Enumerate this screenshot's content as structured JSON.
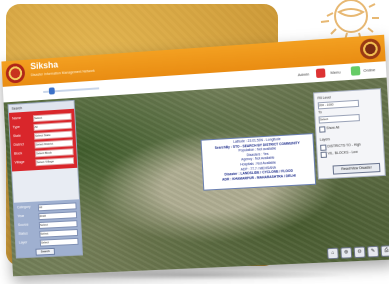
{
  "app": {
    "title": "Siksha",
    "subtitle": "Disaster Information Management Network"
  },
  "toolbar": {
    "user_label": "Admin",
    "menu_label": "Menu",
    "status_label": "Online"
  },
  "left_panel": {
    "header": "Search",
    "red_rows": [
      {
        "label": "Name",
        "value": "Select"
      },
      {
        "label": "Type",
        "value": "All"
      },
      {
        "label": "State",
        "value": "Select State"
      },
      {
        "label": "District",
        "value": "Select District"
      },
      {
        "label": "Block",
        "value": "Select Block"
      },
      {
        "label": "Village",
        "value": "Select Village"
      }
    ],
    "blue_rows": [
      {
        "label": "Category",
        "value": "All"
      },
      {
        "label": "Year",
        "value": "2018"
      },
      {
        "label": "Source",
        "value": "Select"
      },
      {
        "label": "Status",
        "value": "Select"
      },
      {
        "label": "Layer",
        "value": "Select"
      }
    ],
    "search_button": "Search"
  },
  "info_popup": {
    "lines": [
      "Latitude : 23.01.53N - Longitude",
      "SearchBy : STO - SEARCH BY DISTRICT COMMUNITY",
      "Population : Not available",
      "Disasters : Yes",
      "Agency : Not Available",
      "Hospitals : Not Available",
      "ADP : 77.7 / MEHSANA",
      "Disaster : LANDSLIDE / CYCLONE / FLOOD",
      "ADR : KHAMARPUR - MAHARASHTRA / DELHI"
    ]
  },
  "right_panel": {
    "label_a": "Fill Level",
    "input_a": "200 - 1000",
    "label_b": "To",
    "input_b": "Select",
    "check_label": "Show All",
    "legend_title": "Layers",
    "legend_items": [
      "DISTRICTS TO - High",
      "VIL. BLOCKS - Low"
    ],
    "button": "Reset/View Disaster"
  },
  "bottom_tools": [
    "⌂",
    "⊕",
    "⊖",
    "✎",
    "⎙"
  ]
}
